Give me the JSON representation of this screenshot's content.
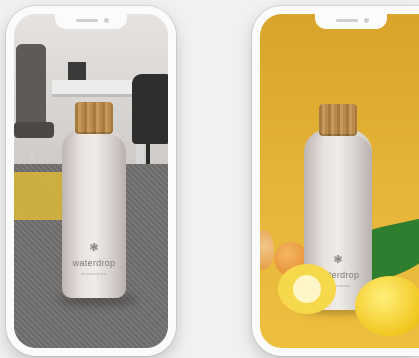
{
  "phones": [
    {
      "scene": "office",
      "bottle": {
        "logo_icon": "waterdrop-logo-icon",
        "brand": "waterdrop",
        "tagline": "MICRODRINK"
      }
    },
    {
      "scene": "yellow-backdrop-with-citrus",
      "bottle": {
        "logo_icon": "waterdrop-logo-icon",
        "brand": "waterdrop",
        "tagline": "MICRODRINK"
      }
    }
  ],
  "colors": {
    "backdrop_yellow": "#e6b53a",
    "cap_bamboo": "#b98a4c",
    "bottle_white": "#ede8e4",
    "page_bg": "#f1f1f1"
  }
}
